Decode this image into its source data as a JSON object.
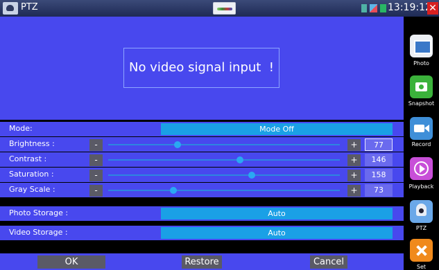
{
  "app": {
    "title": "PTZ",
    "clock": "13:19:12"
  },
  "icons": {
    "app": "camera-icon",
    "center": "signal-wave-icon",
    "sd": "sd-card-icon",
    "network": "network-icon",
    "battery": "battery-icon",
    "close": "close-icon"
  },
  "video": {
    "message": "No video signal input  !"
  },
  "settings": {
    "mode": {
      "label": "Mode:",
      "value": "Mode Off"
    },
    "brightness": {
      "label": "Brightness :",
      "value": "77",
      "level": 0.3
    },
    "contrast": {
      "label": "Contrast :",
      "value": "146",
      "level": 0.57
    },
    "saturation": {
      "label": "Saturation :",
      "value": "158",
      "level": 0.62
    },
    "grayscale": {
      "label": "Gray Scale :",
      "value": "73",
      "level": 0.28
    },
    "photo_storage": {
      "label": "Photo Storage :",
      "value": "Auto"
    },
    "video_storage": {
      "label": "Video Storage :",
      "value": "Auto"
    },
    "minus": "-",
    "plus": "+"
  },
  "actions": {
    "ok": "OK",
    "restore": "Restore",
    "cancel": "Cancel"
  },
  "sidebar": {
    "items": [
      {
        "label": "Photo",
        "icon": "photo-icon"
      },
      {
        "label": "Snapshot",
        "icon": "snapshot-icon"
      },
      {
        "label": "Record",
        "icon": "record-icon"
      },
      {
        "label": "Playback",
        "icon": "playback-icon"
      },
      {
        "label": "PTZ",
        "icon": "ptz-icon"
      },
      {
        "label": "Set",
        "icon": "settings-icon"
      }
    ]
  },
  "colors": {
    "video_bg": "#4848ee",
    "accent_bar": "#1aa0e6",
    "close": "#d82020"
  }
}
